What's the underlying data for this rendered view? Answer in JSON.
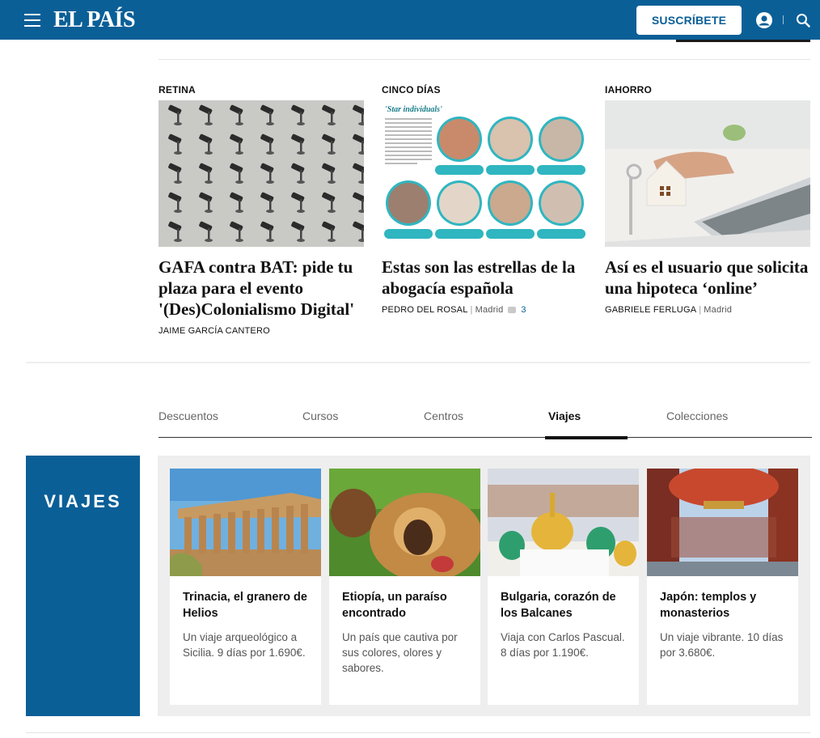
{
  "header": {
    "logo": "EL PAÍS",
    "subscribe_label": "SUSCRÍBETE",
    "brand_color": "#0b5f97"
  },
  "articles": [
    {
      "section": "RETINA",
      "title": "GAFA contra BAT: pide tu plaza para el evento '(Des)Colonialismo Digital'",
      "author": "JAIME GARCÍA CANTERO",
      "location": "",
      "comments": ""
    },
    {
      "section": "CINCO DÍAS",
      "title": "Estas son las estrellas de la abogacía española",
      "author": "PEDRO DEL ROSAL",
      "location": "Madrid",
      "comments": "3",
      "image_heading": "'Star individuals'"
    },
    {
      "section": "IAHORRO",
      "title": "Así es el usuario que solicita una hipoteca ‘online’",
      "author": "GABRIELE FERLUGA",
      "location": "Madrid",
      "comments": ""
    }
  ],
  "tabs": [
    {
      "label": "Descuentos",
      "active": false
    },
    {
      "label": "Cursos",
      "active": false
    },
    {
      "label": "Centros",
      "active": false
    },
    {
      "label": "Viajes",
      "active": true
    },
    {
      "label": "Colecciones",
      "active": false
    }
  ],
  "viajes": {
    "label": "VIAJES",
    "cards": [
      {
        "title": "Trinacia, el granero de Helios",
        "description": "Un viaje arqueológico a Sicilia. 9 días por 1.690€."
      },
      {
        "title": "Etiopía, un paraíso encontrado",
        "description": "Un país que cautiva por sus colores, olores y sabores."
      },
      {
        "title": "Bulgaria, corazón de los Balcanes",
        "description": "Viaja con Carlos Pascual. 8 días por 1.190€."
      },
      {
        "title": "Japón: templos y monasterios",
        "description": "Un viaje vibrante. 10 días por 3.680€."
      }
    ]
  }
}
